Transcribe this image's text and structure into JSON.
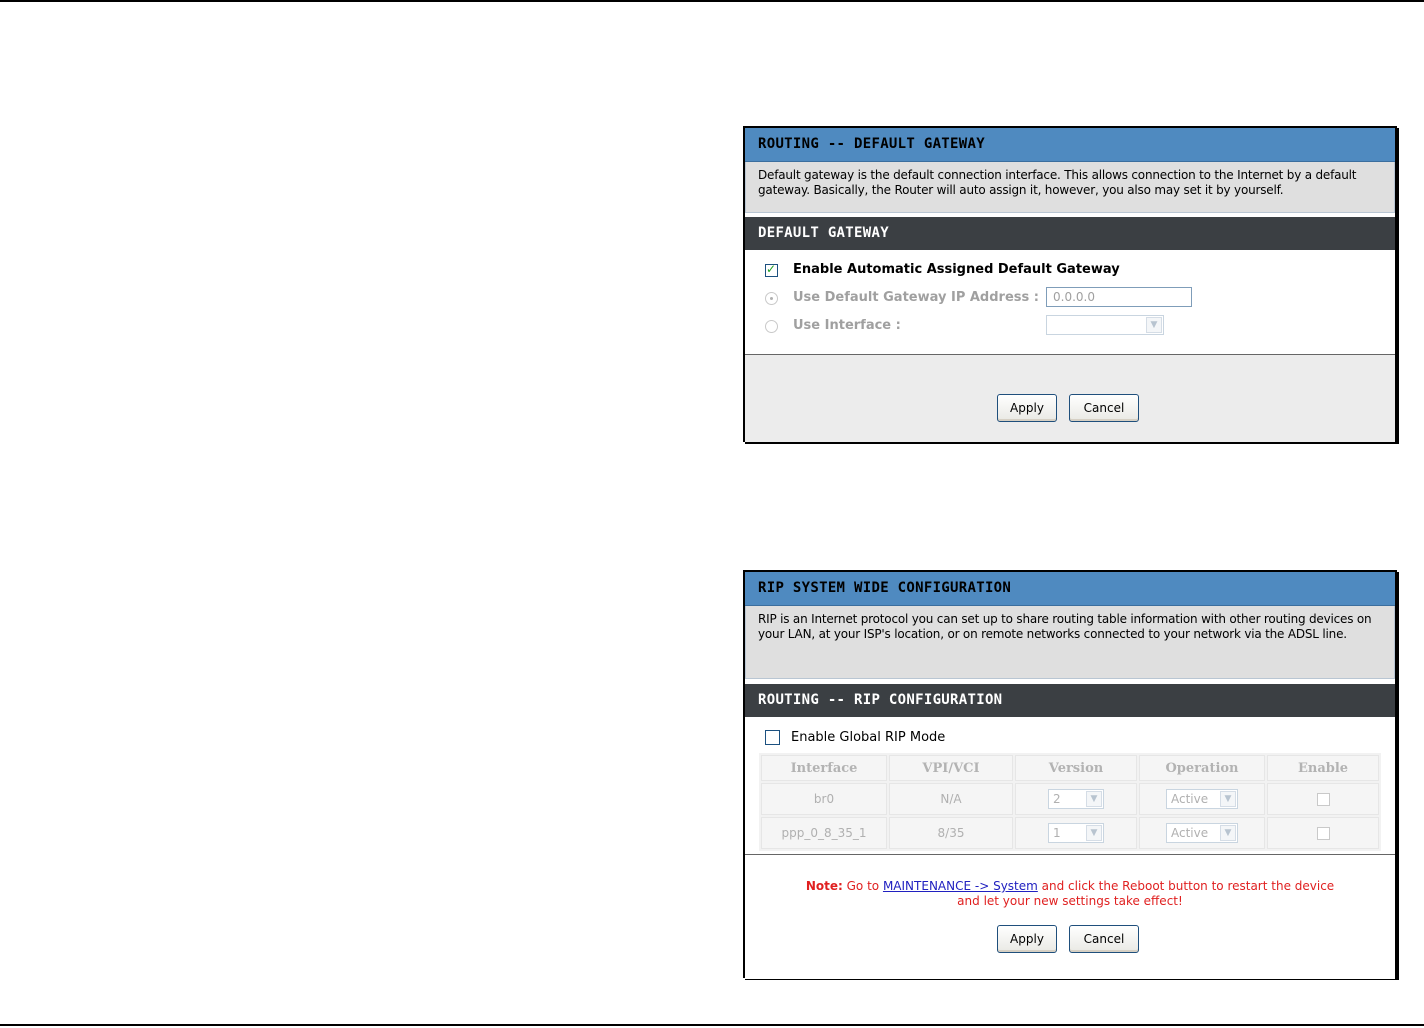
{
  "gateway_panel": {
    "title": "ROUTING -- DEFAULT GATEWAY",
    "description": "Default gateway is the default connection interface. This allows connection to the Internet by a default gateway. Basically, the Router will auto assign it, however, you also may set it by yourself.",
    "section_title": "DEFAULT GATEWAY",
    "enable_auto_label": "Enable Automatic Assigned Default Gateway",
    "enable_auto_checked": true,
    "use_ip_label": "Use Default Gateway IP Address :",
    "ip_value": "0.0.0.0",
    "use_interface_label": "Use Interface :",
    "interface_value": "",
    "apply_label": "Apply",
    "cancel_label": "Cancel"
  },
  "rip_panel": {
    "title": "RIP SYSTEM WIDE CONFIGURATION",
    "description": "RIP is an Internet protocol you can set up to share routing table information with other routing devices on your LAN, at your ISP's location, or on remote networks connected to your network via the ADSL line.",
    "section_title": "ROUTING -- RIP CONFIGURATION",
    "enable_global_label": "Enable Global RIP Mode",
    "enable_global_checked": false,
    "columns": [
      "Interface",
      "VPI/VCI",
      "Version",
      "Operation",
      "Enable"
    ],
    "rows": [
      {
        "interface": "br0",
        "vpi_vci": "N/A",
        "version": "2",
        "operation": "Active",
        "enabled": false
      },
      {
        "interface": "ppp_0_8_35_1",
        "vpi_vci": "8/35",
        "version": "1",
        "operation": "Active",
        "enabled": false
      }
    ],
    "note_label": "Note:",
    "note_prefix": "Go to",
    "note_link": "MAINTENANCE -> System",
    "note_suffix": "and click the Reboot button to restart the device",
    "note_line2": "and let your new settings take effect!",
    "apply_label": "Apply",
    "cancel_label": "Cancel"
  }
}
